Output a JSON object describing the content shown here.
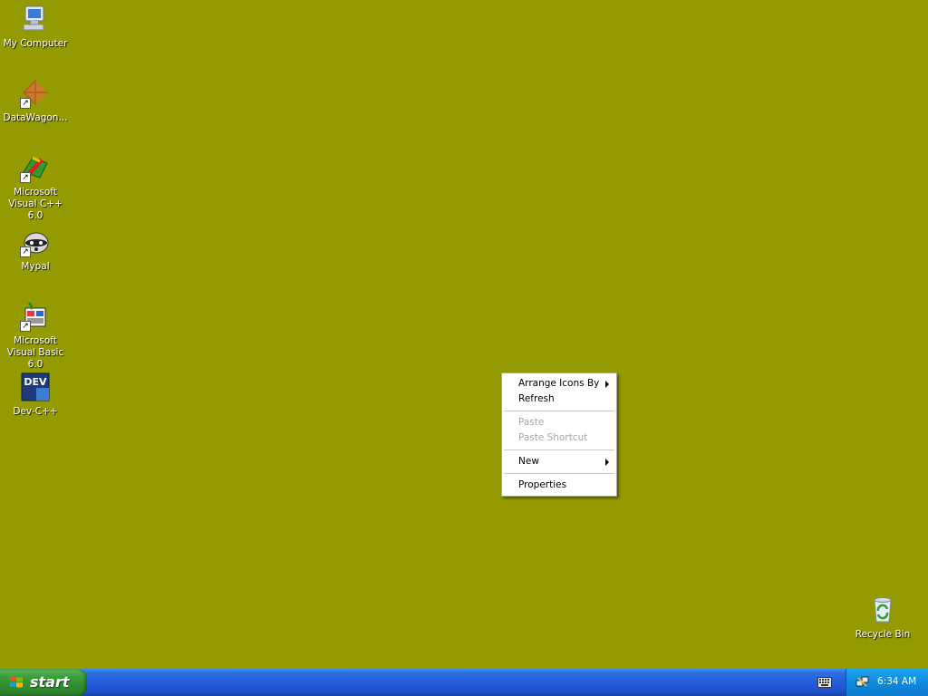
{
  "desktop": {
    "background": "#949B00",
    "icons": [
      {
        "label": "My Computer"
      },
      {
        "label": "DataWagon..."
      },
      {
        "label": "Microsoft Visual C++ 6.0"
      },
      {
        "label": "Mypal"
      },
      {
        "label": "Microsoft Visual Basic 6.0"
      },
      {
        "label": "Dev-C++"
      },
      {
        "label": "Recycle Bin"
      }
    ],
    "dev_icon_text": "DEV"
  },
  "context_menu": {
    "items": [
      {
        "label": "Arrange Icons By",
        "submenu": true,
        "enabled": true
      },
      {
        "label": "Refresh",
        "enabled": true
      },
      {
        "label": "Paste",
        "enabled": false
      },
      {
        "label": "Paste Shortcut",
        "enabled": false
      },
      {
        "label": "New",
        "submenu": true,
        "enabled": true
      },
      {
        "label": "Properties",
        "enabled": true
      }
    ]
  },
  "taskbar": {
    "start_label": "start",
    "clock": "6:34 AM"
  }
}
